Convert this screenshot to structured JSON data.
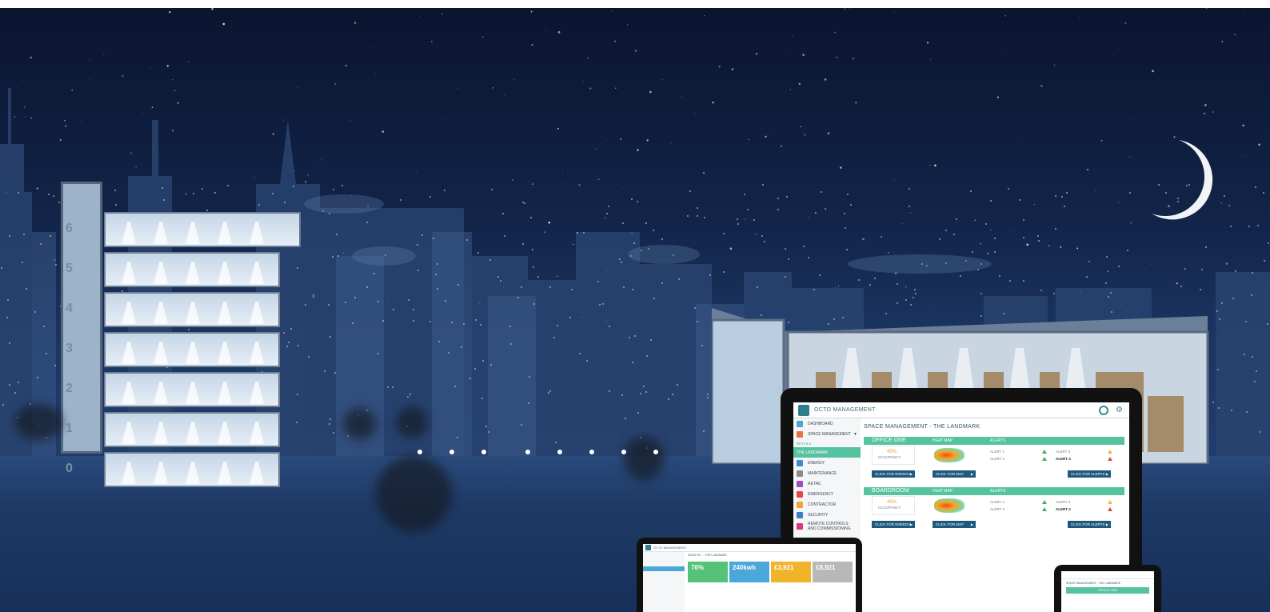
{
  "app": {
    "title": "OCTO MANAGEMENT",
    "logo_caption": "OCTO"
  },
  "sidebar": {
    "items": [
      {
        "label": "DASHBOARD",
        "icon": "dashboard-icon",
        "color": "#4aa7c9"
      },
      {
        "label": "SPACE MANAGEMENT",
        "icon": "space-icon",
        "color": "#e8743b",
        "caret": "▼"
      },
      {
        "label": "DETAILS",
        "section": true
      },
      {
        "label": "THE LANDMARK",
        "active": true
      },
      {
        "label": "ENERGY",
        "icon": "energy-icon",
        "color": "#3a8fd0"
      },
      {
        "label": "MAINTENANCE",
        "icon": "maintenance-icon",
        "color": "#8a8a8a"
      },
      {
        "label": "RETAIL",
        "icon": "retail-icon",
        "color": "#9b4fc2"
      },
      {
        "label": "EMERGENCY",
        "icon": "emergency-icon",
        "color": "#e24848"
      },
      {
        "label": "CONTRACTOR",
        "icon": "contractor-icon",
        "color": "#f0a431"
      },
      {
        "label": "SECURITY",
        "icon": "security-icon",
        "color": "#3b7fc4"
      },
      {
        "label": "REMOTE CONTROLS AND COMMISSIONING",
        "icon": "remote-icon",
        "color": "#d6387a"
      }
    ]
  },
  "main": {
    "heading": "SPACE MANAGEMENT - THE LANDMARK",
    "panels": [
      {
        "title": "OFFICE ONE",
        "col_heatmap": "HEAT MAP",
        "col_alerts": "ALERTS",
        "occupancy_value": "45%",
        "occupancy_label": "OCCUPANCY",
        "alerts_left": [
          "ALERT 1",
          "ALERT 2"
        ],
        "alerts_right": [
          "ALERT 3",
          "ALERT 4"
        ],
        "btn_energy": "CLICK FOR ENERGY",
        "btn_map": "CLICK FOR MAP",
        "btn_alerts": "CLICK FOR ALERTS"
      },
      {
        "title": "BOARDROOM",
        "col_heatmap": "HEAT MAP",
        "col_alerts": "ALERTS",
        "occupancy_value": "45%",
        "occupancy_label": "OCCUPANCY",
        "alerts_left": [
          "ALERT 1",
          "ALERT 2"
        ],
        "alerts_right": [
          "ALERT 3",
          "ALERT 4"
        ],
        "btn_energy": "CLICK FOR ENERGY",
        "btn_map": "CLICK FOR MAP",
        "btn_alerts": "CLICK FOR ALERTS"
      }
    ]
  },
  "tablet": {
    "title": "OCTO MANAGEMENT",
    "heading": "SPACE M... - THE LANDMARK",
    "tiles": [
      {
        "value": "76%",
        "color": "#55c27a"
      },
      {
        "value": "240kwh",
        "color": "#4aa7d8"
      },
      {
        "value": "£3,921",
        "color": "#f0b32a"
      },
      {
        "value": "£8,921",
        "color": "#b8b8b8"
      }
    ]
  },
  "phone": {
    "heading": "SPACE MANAGEMENT - THE LANDMARK",
    "panel": "OFFICE ONE"
  },
  "building": {
    "floors": [
      "6",
      "5",
      "4",
      "3",
      "2",
      "1",
      "0"
    ]
  },
  "colors": {
    "accent": "#55c2a0",
    "button": "#1e5a7e",
    "sky_top": "#0a1530",
    "sky_bottom": "#203c6c"
  }
}
